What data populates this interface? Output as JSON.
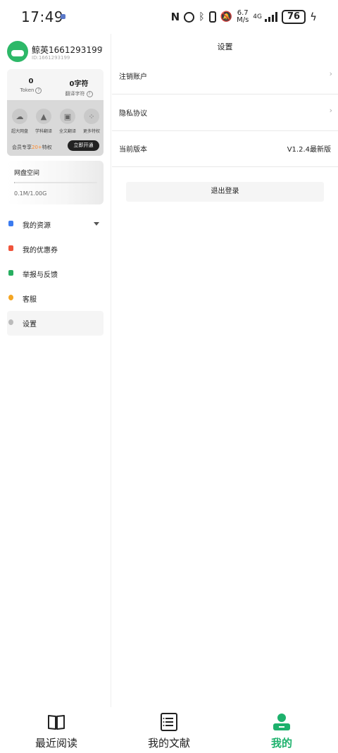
{
  "status_bar": {
    "time": "17:49",
    "speed_value": "6.7",
    "speed_unit": "M/s",
    "network": "4G",
    "battery": "76"
  },
  "sidebar": {
    "profile": {
      "name": "鲸英1661293199",
      "uid": "ID:1661293199"
    },
    "stats": [
      {
        "value": "0",
        "label": "Token"
      },
      {
        "value": "0字符",
        "label": "翻译字符"
      }
    ],
    "features": [
      {
        "label": "超大网盘",
        "icon": "cloud-icon"
      },
      {
        "label": "学科翻译",
        "icon": "graduation-cap-icon"
      },
      {
        "label": "全文翻译",
        "icon": "translate-icon"
      },
      {
        "label": "更多特权",
        "icon": "grid-icon"
      }
    ],
    "member": {
      "prefix": "会员专享",
      "highlight": "20+",
      "suffix": "特权",
      "button": "立即开通"
    },
    "disk": {
      "title": "网盘空间",
      "usage": "0.1M/1.00G",
      "used_fraction": 0.0001
    },
    "menu": [
      {
        "label": "我的资源",
        "icon": "resource-icon",
        "color": "#3b7bf0",
        "expandable": true
      },
      {
        "label": "我的优惠券",
        "icon": "coupon-icon",
        "color": "#f0543b",
        "expandable": false
      },
      {
        "label": "举报与反馈",
        "icon": "feedback-icon",
        "color": "#27ae60",
        "expandable": false
      },
      {
        "label": "客服",
        "icon": "service-icon",
        "color": "#f4a623",
        "expandable": false
      },
      {
        "label": "设置",
        "icon": "settings-icon",
        "color": "#bbbbbb",
        "expandable": false,
        "active": true
      }
    ]
  },
  "main": {
    "title": "设置",
    "rows": [
      {
        "label": "注销账户",
        "chevron": "›"
      },
      {
        "label": "隐私协议",
        "chevron": "›"
      },
      {
        "label": "当前版本",
        "value": "V1.2.4最新版"
      }
    ],
    "logout_label": "退出登录"
  },
  "bottom_nav": [
    {
      "label": "最近阅读",
      "icon": "book-icon"
    },
    {
      "label": "我的文献",
      "icon": "document-list-icon"
    },
    {
      "label": "我的",
      "icon": "user-icon",
      "active": true
    }
  ],
  "colors": {
    "accent": "#1db16c",
    "member_highlight": "#ff8a2a"
  }
}
